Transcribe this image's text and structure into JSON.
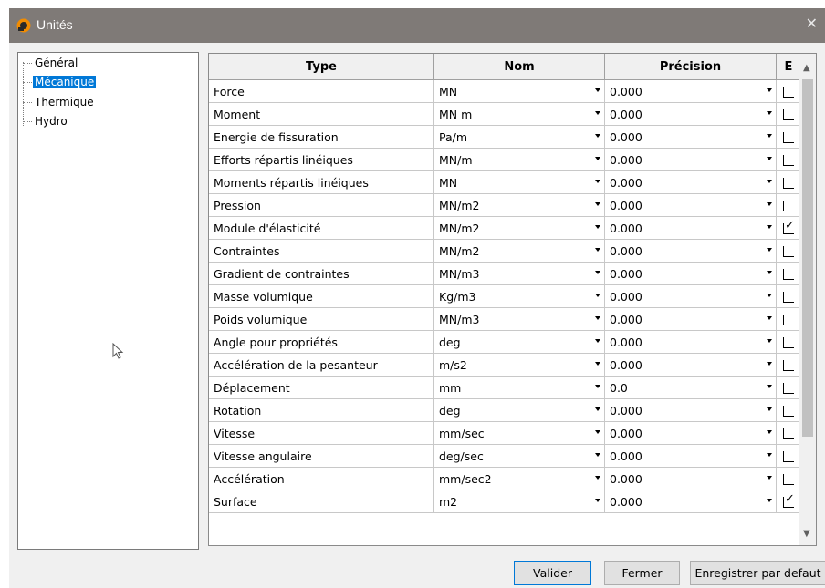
{
  "window": {
    "title": "Unités",
    "close_glyph": "✕"
  },
  "tree": {
    "items": [
      {
        "label": "Général",
        "selected": false
      },
      {
        "label": "Mécanique",
        "selected": true
      },
      {
        "label": "Thermique",
        "selected": false
      },
      {
        "label": "Hydro",
        "selected": false
      }
    ]
  },
  "grid": {
    "columns": {
      "type": "Type",
      "nom": "Nom",
      "precision": "Précision",
      "e": "E"
    },
    "rows": [
      {
        "type": "Force",
        "nom": "MN",
        "precision": "0.000",
        "checked": false
      },
      {
        "type": "Moment",
        "nom": "MN m",
        "precision": "0.000",
        "checked": false
      },
      {
        "type": "Energie de fissuration",
        "nom": "Pa/m",
        "precision": "0.000",
        "checked": false
      },
      {
        "type": "Efforts répartis linéiques",
        "nom": "MN/m",
        "precision": "0.000",
        "checked": false
      },
      {
        "type": "Moments répartis linéiques",
        "nom": "MN",
        "precision": "0.000",
        "checked": false
      },
      {
        "type": "Pression",
        "nom": "MN/m2",
        "precision": "0.000",
        "checked": false
      },
      {
        "type": "Module d'élasticité",
        "nom": "MN/m2",
        "precision": "0.000",
        "checked": true
      },
      {
        "type": "Contraintes",
        "nom": "MN/m2",
        "precision": "0.000",
        "checked": false
      },
      {
        "type": "Gradient de contraintes",
        "nom": "MN/m3",
        "precision": "0.000",
        "checked": false
      },
      {
        "type": "Masse volumique",
        "nom": "Kg/m3",
        "precision": "0.000",
        "checked": false
      },
      {
        "type": "Poids volumique",
        "nom": "MN/m3",
        "precision": "0.000",
        "checked": false
      },
      {
        "type": "Angle pour propriétés",
        "nom": "deg",
        "precision": "0.000",
        "checked": false
      },
      {
        "type": "Accélération de la pesanteur",
        "nom": "m/s2",
        "precision": "0.000",
        "checked": false
      },
      {
        "type": "Déplacement",
        "nom": "mm",
        "precision": "0.0",
        "checked": false
      },
      {
        "type": "Rotation",
        "nom": "deg",
        "precision": "0.000",
        "checked": false
      },
      {
        "type": "Vitesse",
        "nom": "mm/sec",
        "precision": "0.000",
        "checked": false
      },
      {
        "type": "Vitesse angulaire",
        "nom": "deg/sec",
        "precision": "0.000",
        "checked": false
      },
      {
        "type": "Accélération",
        "nom": "mm/sec2",
        "precision": "0.000",
        "checked": false
      },
      {
        "type": "Surface",
        "nom": "m2",
        "precision": "0.000",
        "checked": true
      }
    ]
  },
  "buttons": {
    "validate": "Valider",
    "close": "Fermer",
    "save_default": "Enregistrer par defaut"
  }
}
